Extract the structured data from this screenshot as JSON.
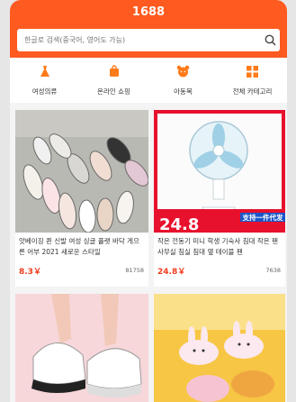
{
  "app": {
    "title": "1688"
  },
  "search": {
    "placeholder": "한글로 검색(중국어, 영어도 가능)"
  },
  "categories": [
    {
      "label": "여성의류",
      "icon": "dress-icon"
    },
    {
      "label": "온라인 쇼핑",
      "icon": "shopping-bag-icon"
    },
    {
      "label": "아동복",
      "icon": "bear-icon"
    },
    {
      "label": "전체 카테고리",
      "icon": "grid-icon"
    }
  ],
  "products": [
    {
      "title": "앗베이징 퀸 신발 여성 싱글 플랫 바닥 게으른 어부 2021 새로운 스타일",
      "price": "8.3￥",
      "sold": "81758"
    },
    {
      "title": "작은 전동기 미니 학생 기숙사 침대 작은 팬 사무실 침실 침대 옆 테이블 팬",
      "price": "24.8￥",
      "sold": "7638"
    },
    {
      "title": "",
      "price": "",
      "sold": ""
    },
    {
      "title": "",
      "price": "",
      "sold": ""
    }
  ],
  "banner": {
    "tag": "支持一件代发",
    "big_text": "24.8"
  },
  "colors": {
    "brand": "#ff5a1f",
    "price": "#f03c1e"
  }
}
